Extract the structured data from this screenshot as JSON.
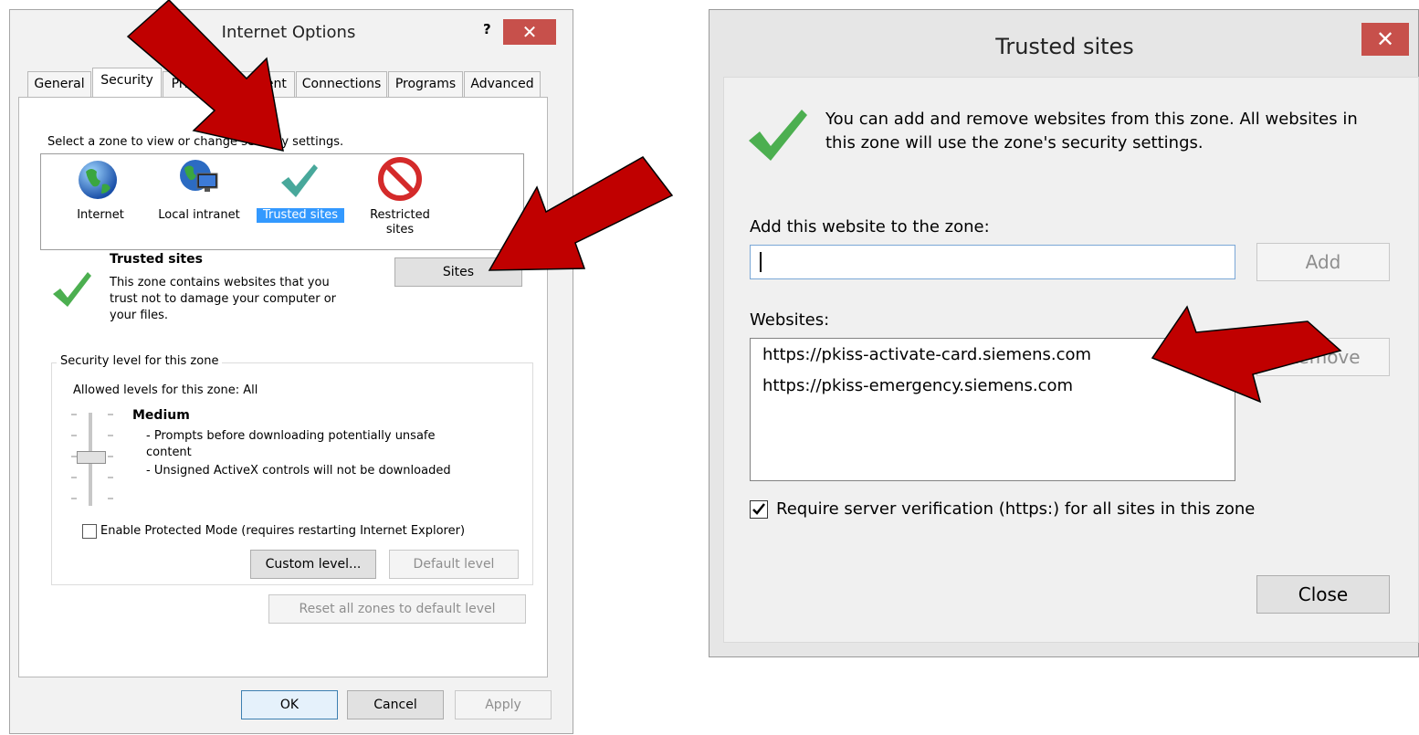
{
  "internet_options": {
    "title": "Internet Options",
    "help": "?",
    "close": "✕",
    "tabs": [
      {
        "label": "General"
      },
      {
        "label": "Security"
      },
      {
        "label": "Privacy"
      },
      {
        "label": "Content"
      },
      {
        "label": "Connections"
      },
      {
        "label": "Programs"
      },
      {
        "label": "Advanced"
      }
    ],
    "zone_prompt": "Select a zone to view or change security settings.",
    "zones": [
      {
        "label": "Internet",
        "icon": "globe-icon"
      },
      {
        "label": "Local intranet",
        "icon": "intranet-icon"
      },
      {
        "label": "Trusted sites",
        "icon": "checkmark-icon",
        "selected": true
      },
      {
        "label": "Restricted sites",
        "icon": "no-entry-icon"
      }
    ],
    "zone_info": {
      "heading": "Trusted sites",
      "description_lines": [
        "This zone contains websites that you",
        "trust not to damage your computer or",
        "your files."
      ]
    },
    "sites_button": "Sites",
    "security_level": {
      "group_label": "Security level for this zone",
      "allowed": "Allowed levels for this zone: All",
      "level_name": "Medium",
      "details": [
        "- Prompts before downloading potentially unsafe",
        "content",
        "- Unsigned ActiveX controls will not be downloaded"
      ],
      "slider_position": 0.5
    },
    "protected_mode": {
      "label": "Enable Protected Mode (requires restarting Internet Explorer)",
      "checked": false
    },
    "custom_level_button": "Custom level...",
    "default_level_button": "Default level",
    "reset_all_button": "Reset all zones to default level",
    "ok_button": "OK",
    "cancel_button": "Cancel",
    "apply_button": "Apply"
  },
  "trusted_sites": {
    "title": "Trusted sites",
    "close": "✕",
    "info_text_lines": [
      "You can add and remove websites from this zone. All websites in",
      "this zone will use the zone's security settings."
    ],
    "add_label": "Add this website to the zone:",
    "add_input_value": "",
    "add_button": "Add",
    "websites_label": "Websites:",
    "websites": [
      "https://pkiss-activate-card.siemens.com",
      "https://pkiss-emergency.siemens.com"
    ],
    "remove_button": "Remove",
    "require_verification": {
      "label": "Require server verification (https:) for all sites in this zone",
      "checked": true
    },
    "close_button": "Close"
  },
  "colors": {
    "arrow": "#c00000",
    "selection": "#3399ff",
    "close_button": "#c7504b",
    "check_green": "#4caf50"
  }
}
